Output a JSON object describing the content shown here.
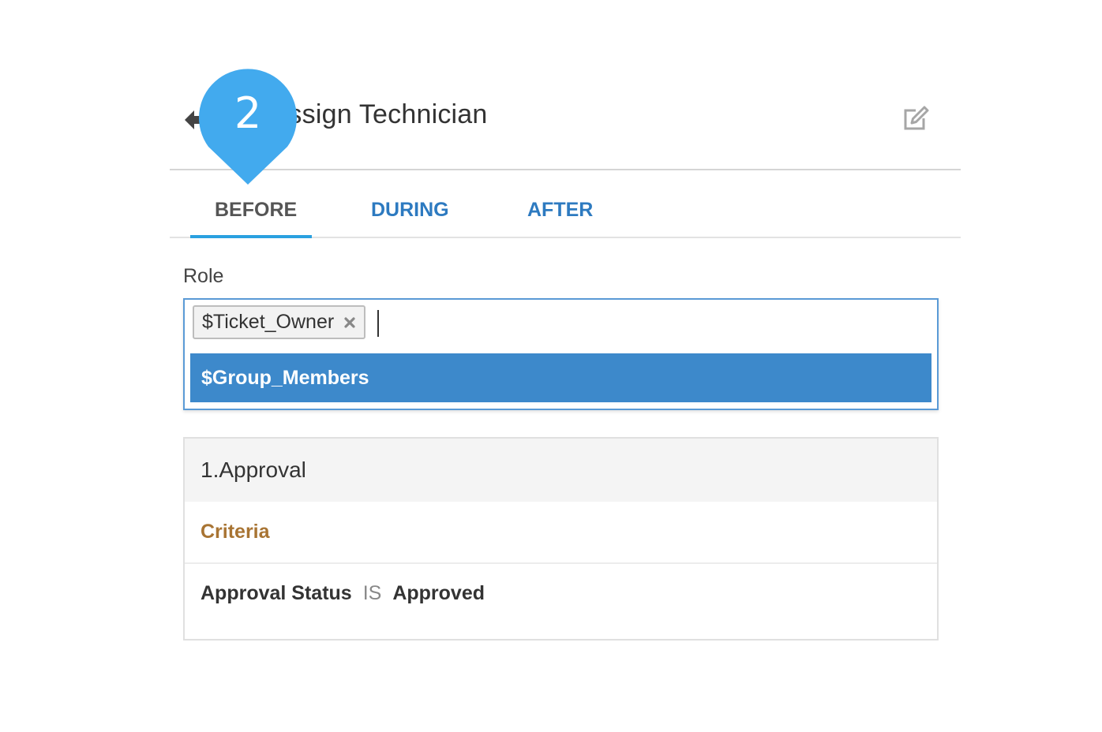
{
  "header": {
    "title": "tion - Assign Technician",
    "back_icon": "back-arrow-icon",
    "edit_icon": "edit-icon"
  },
  "step_marker": {
    "number": "2",
    "color": "#42aaee"
  },
  "tabs": [
    {
      "label": "BEFORE",
      "active": true
    },
    {
      "label": "DURING",
      "active": false
    },
    {
      "label": "AFTER",
      "active": false
    }
  ],
  "role": {
    "label": "Role",
    "selected_tags": [
      "$Ticket_Owner"
    ],
    "remove_icon": "close-icon",
    "options": [
      "$Group_Members"
    ]
  },
  "approval": {
    "title": "1.Approval",
    "criteria_label": "Criteria",
    "condition": {
      "field": "Approval Status",
      "operator": "IS",
      "value": "Approved"
    }
  },
  "colors": {
    "accent": "#2aa1e0",
    "tab_link": "#2d7ac0",
    "option_highlight": "#3d89cb",
    "criteria": "#a87433"
  }
}
